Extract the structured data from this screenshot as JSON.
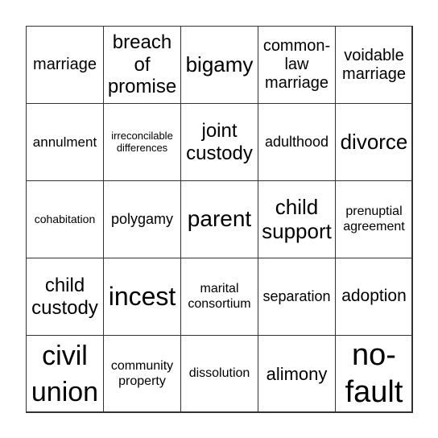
{
  "cells": [
    "marriage",
    "breach of promise",
    "bigamy",
    "common-law marriage",
    "voidable marriage",
    "annulment",
    "irreconcilable differences",
    "joint custody",
    "adulthood",
    "divorce",
    "cohabitation",
    "polygamy",
    "parent",
    "child support",
    "prenuptial agreement",
    "child custody",
    "incest",
    "marital consortium",
    "separation",
    "adoption",
    "civil union",
    "community property",
    "dissolution",
    "alimony",
    "no-fault"
  ]
}
